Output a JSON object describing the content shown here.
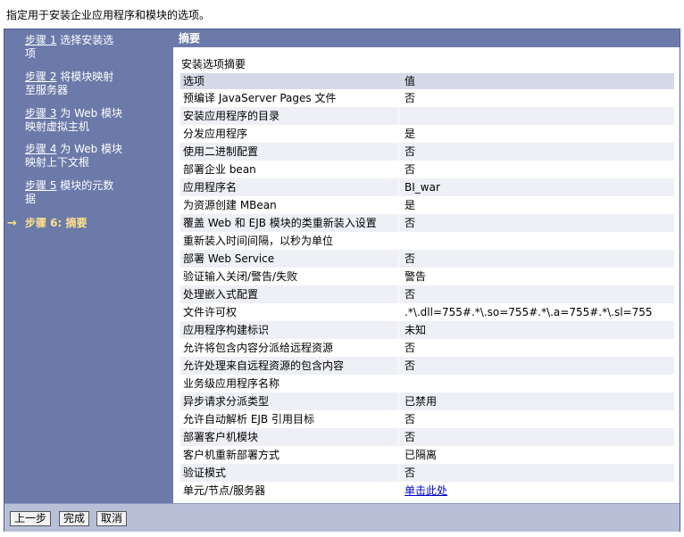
{
  "intro": "指定用于安装企业应用程序和模块的选项。",
  "sidebar": {
    "steps": [
      {
        "num": "步骤 1",
        "label": " 选择安装选项"
      },
      {
        "num": "步骤 2",
        "label": " 将模块映射至服务器"
      },
      {
        "num": "步骤 3",
        "label": " 为 Web 模块映射虚拟主机"
      },
      {
        "num": "步骤 4",
        "label": " 为 Web 模块映射上下文根"
      },
      {
        "num": "步骤 5",
        "label": " 模块的元数据"
      }
    ],
    "current_arrow": "→",
    "current_step": "步骤 6: 摘要"
  },
  "content": {
    "header": "摘要",
    "subtitle": "安装选项摘要",
    "columns": {
      "option": "选项",
      "value": "值"
    },
    "rows": [
      {
        "option": "预编译 JavaServer Pages 文件",
        "value": "否"
      },
      {
        "option": "安装应用程序的目录",
        "value": ""
      },
      {
        "option": "分发应用程序",
        "value": "是"
      },
      {
        "option": "使用二进制配置",
        "value": "否"
      },
      {
        "option": "部署企业 bean",
        "value": "否"
      },
      {
        "option": "应用程序名",
        "value": "BI_war"
      },
      {
        "option": "为资源创建 MBean",
        "value": "是"
      },
      {
        "option": "覆盖 Web 和 EJB 模块的类重新装入设置",
        "value": "否"
      },
      {
        "option": "重新装入时间间隔，以秒为单位",
        "value": ""
      },
      {
        "option": "部署 Web Service",
        "value": "否"
      },
      {
        "option": "验证输入关闭/警告/失败",
        "value": "警告"
      },
      {
        "option": "处理嵌入式配置",
        "value": "否"
      },
      {
        "option": "文件许可权",
        "value": ".*\\.dll=755#.*\\.so=755#.*\\.a=755#.*\\.sl=755"
      },
      {
        "option": "应用程序构建标识",
        "value": "未知"
      },
      {
        "option": "允许将包含内容分派给远程资源",
        "value": "否"
      },
      {
        "option": "允许处理来自远程资源的包含内容",
        "value": "否"
      },
      {
        "option": "业务级应用程序名称",
        "value": ""
      },
      {
        "option": "异步请求分派类型",
        "value": "已禁用"
      },
      {
        "option": "允许自动解析 EJB 引用目标",
        "value": "否"
      },
      {
        "option": "部署客户机模块",
        "value": "否"
      },
      {
        "option": "客户机重新部署方式",
        "value": "已隔离"
      },
      {
        "option": "验证模式",
        "value": "否"
      },
      {
        "option": "单元/节点/服务器",
        "value": "单击此处",
        "link": true
      }
    ]
  },
  "footer": {
    "prev_label": "上一步",
    "finish_label": "完成",
    "cancel_label": "取消"
  },
  "colors": {
    "panel": "#6b7aa9",
    "current_step": "#ffe08a",
    "table_head": "#d5dae8",
    "footer": "#b8c0d8",
    "link": "#0000cc"
  }
}
